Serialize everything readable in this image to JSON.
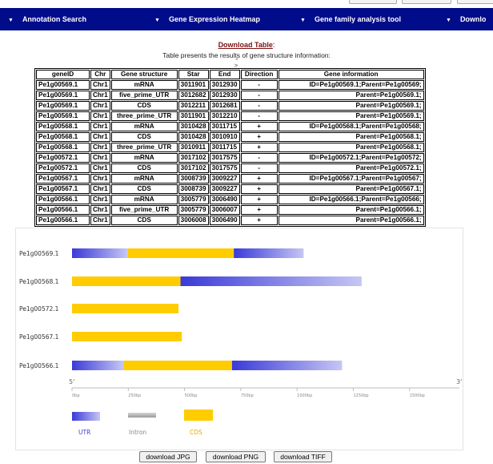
{
  "nav": {
    "items": [
      {
        "label": "Annotation Search"
      },
      {
        "label": "Gene Expression Heatmap"
      },
      {
        "label": "Gene family analysis tool"
      },
      {
        "label": "Downlo"
      }
    ]
  },
  "header": {
    "download_link": "Download Table",
    "colon": ":",
    "subtitle": "Table presents the results of gene structure information:"
  },
  "table": {
    "columns": [
      "geneID",
      "Chr",
      "Gene structure",
      "Star",
      "End",
      "Direction",
      "Gene information"
    ],
    "rows": [
      [
        "Pe1g00569.1",
        "Chr1",
        "mRNA",
        "3011901",
        "3012930",
        "-",
        "ID=Pe1g00569.1;Parent=Pe1g00569;"
      ],
      [
        "Pe1g00569.1",
        "Chr1",
        "five_prime_UTR",
        "3012682",
        "3012930",
        "-",
        "Parent=Pe1g00569.1;"
      ],
      [
        "Pe1g00569.1",
        "Chr1",
        "CDS",
        "3012211",
        "3012681",
        "-",
        "Parent=Pe1g00569.1;"
      ],
      [
        "Pe1g00569.1",
        "Chr1",
        "three_prime_UTR",
        "3011901",
        "3012210",
        "-",
        "Parent=Pe1g00569.1;"
      ],
      [
        "Pe1g00568.1",
        "Chr1",
        "mRNA",
        "3010428",
        "3011715",
        "+",
        "ID=Pe1g00568.1;Parent=Pe1g00568;"
      ],
      [
        "Pe1g00568.1",
        "Chr1",
        "CDS",
        "3010428",
        "3010910",
        "+",
        "Parent=Pe1g00568.1;"
      ],
      [
        "Pe1g00568.1",
        "Chr1",
        "three_prime_UTR",
        "3010911",
        "3011715",
        "+",
        "Parent=Pe1g00568.1;"
      ],
      [
        "Pe1g00572.1",
        "Chr1",
        "mRNA",
        "3017102",
        "3017575",
        "-",
        "ID=Pe1g00572.1;Parent=Pe1g00572;"
      ],
      [
        "Pe1g00572.1",
        "Chr1",
        "CDS",
        "3017102",
        "3017575",
        "-",
        "Parent=Pe1g00572.1;"
      ],
      [
        "Pe1g00567.1",
        "Chr1",
        "mRNA",
        "3008739",
        "3009227",
        "+",
        "ID=Pe1g00567.1;Parent=Pe1g00567;"
      ],
      [
        "Pe1g00567.1",
        "Chr1",
        "CDS",
        "3008739",
        "3009227",
        "+",
        "Parent=Pe1g00567.1;"
      ],
      [
        "Pe1g00566.1",
        "Chr1",
        "mRNA",
        "3005779",
        "3006490",
        "+",
        "ID=Pe1g00566.1;Parent=Pe1g00566;"
      ],
      [
        "Pe1g00566.1",
        "Chr1",
        "five_prime_UTR",
        "3005779",
        "3006007",
        "+",
        "Parent=Pe1g00566.1;"
      ],
      [
        "Pe1g00566.1",
        "Chr1",
        "CDS",
        "3006008",
        "3006490",
        "+",
        "Parent=Pe1g00566.1;"
      ]
    ]
  },
  "chart_data": {
    "type": "gene-structure",
    "axis": {
      "start_label": "5'",
      "end_label": "3'",
      "ticks": [
        "0bp",
        "250bp",
        "500bp",
        "750bp",
        "1000bp",
        "1250bp",
        "1500bp"
      ],
      "tick_values": [
        0,
        250,
        500,
        750,
        1000,
        1250,
        1500
      ],
      "range": [
        0,
        1700
      ]
    },
    "genes": [
      {
        "name": "Pe1g00569.1",
        "segments": [
          {
            "type": "UTR",
            "start": 0,
            "end": 248
          },
          {
            "type": "CDS",
            "start": 248,
            "end": 719
          },
          {
            "type": "UTR",
            "start": 719,
            "end": 1029
          }
        ]
      },
      {
        "name": "Pe1g00568.1",
        "segments": [
          {
            "type": "CDS",
            "start": 0,
            "end": 482
          },
          {
            "type": "UTR",
            "start": 482,
            "end": 1287
          }
        ]
      },
      {
        "name": "Pe1g00572.1",
        "segments": [
          {
            "type": "CDS",
            "start": 0,
            "end": 473
          }
        ]
      },
      {
        "name": "Pe1g00567.1",
        "segments": [
          {
            "type": "CDS",
            "start": 0,
            "end": 488
          }
        ]
      },
      {
        "name": "Pe1g00566.1",
        "segments": [
          {
            "type": "UTR",
            "start": 0,
            "end": 228
          },
          {
            "type": "CDS",
            "start": 228,
            "end": 711
          },
          {
            "type": "UTR",
            "start": 711,
            "end": 1200
          }
        ]
      }
    ],
    "legend": [
      {
        "label": "UTR",
        "color": "#3a3ad8"
      },
      {
        "label": "Intron",
        "color": "#bbbbbb"
      },
      {
        "label": "CDS",
        "color": "#ffcc00"
      }
    ],
    "colors": {
      "utr": "#3a3ad8",
      "utr_light": "#c6c6f4",
      "cds": "#ffcc00",
      "intron": "#bbbbbb",
      "label_utr": "#3a3ad8",
      "label_intron": "#888888",
      "label_cds": "#f0a800"
    }
  },
  "buttons": {
    "jpg": "download JPG",
    "png": "download PNG",
    "tiff": "download TIFF"
  }
}
